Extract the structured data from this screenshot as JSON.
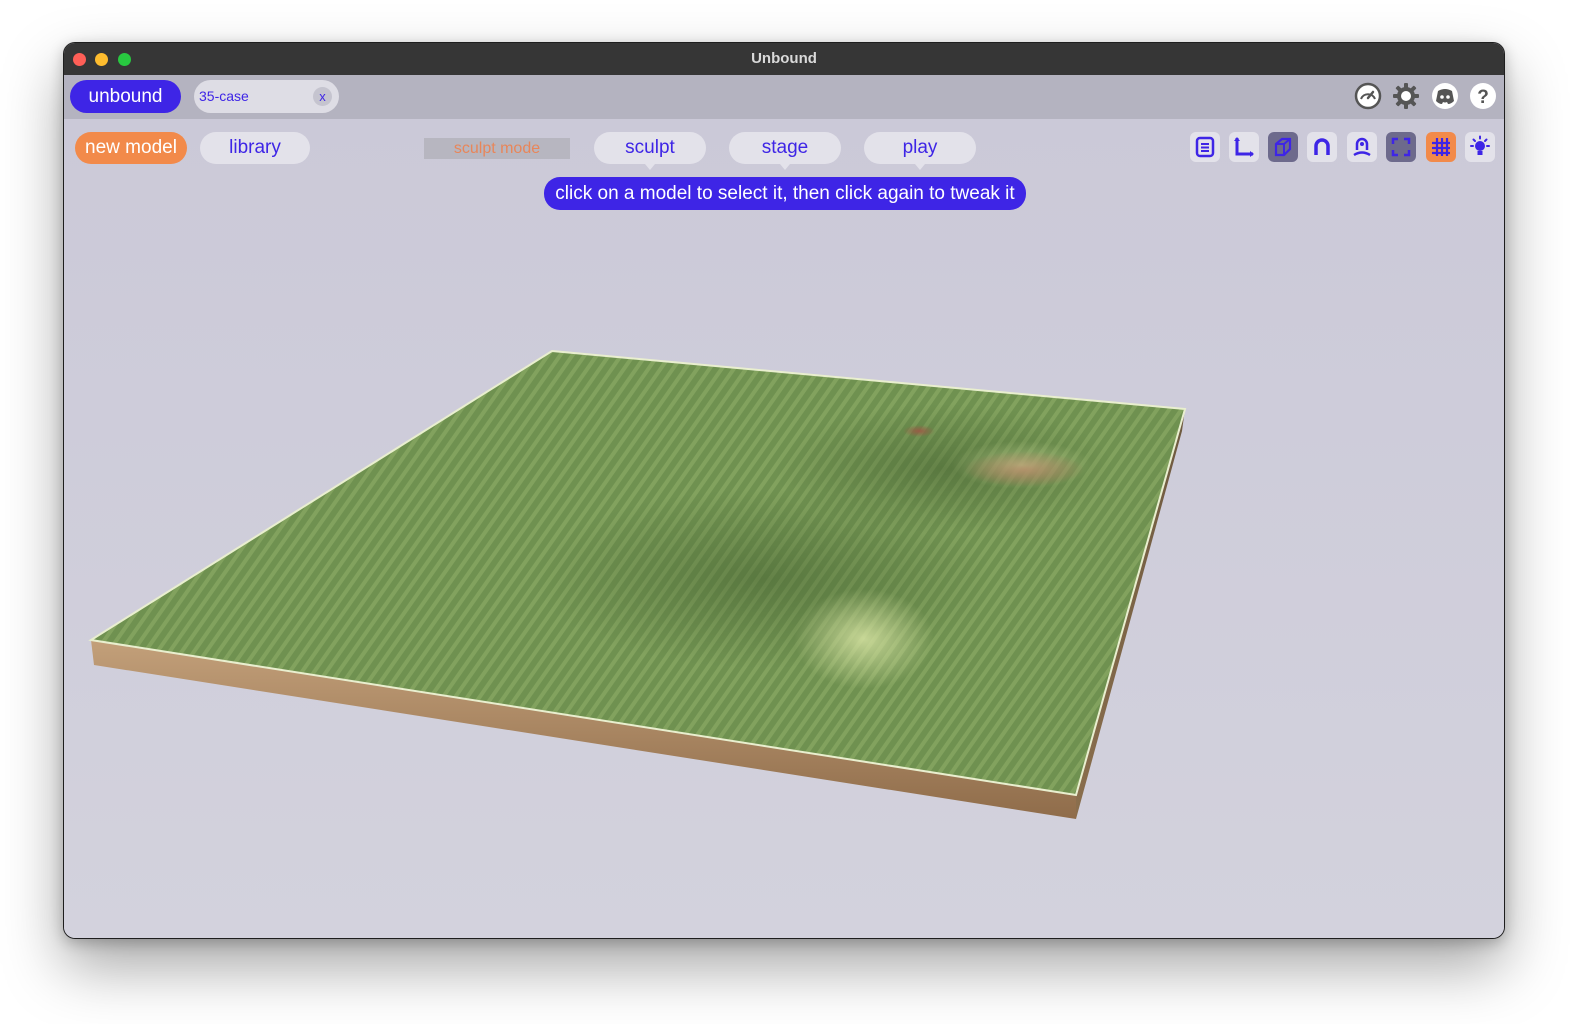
{
  "window": {
    "title": "Unbound"
  },
  "topbar": {
    "brand_label": "unbound",
    "document_tab": {
      "name": "35-case",
      "close_label": "x"
    },
    "icons": [
      "speedometer-icon",
      "gear-icon",
      "discord-icon",
      "help-icon"
    ]
  },
  "toolbar": {
    "new_model_label": "new model",
    "library_label": "library",
    "mode_label": "sculpt mode",
    "tabs": [
      {
        "label": "sculpt"
      },
      {
        "label": "stage"
      },
      {
        "label": "play"
      }
    ],
    "hint": "click on a model to select it, then click again to tweak it",
    "tools": [
      "list-icon",
      "axes-icon",
      "cube-icon",
      "magnet-icon",
      "person-magnet-icon",
      "frame-icon",
      "grid-icon",
      "light-icon"
    ]
  },
  "colors": {
    "accent": "#3e25e6",
    "orange": "#f28a4a",
    "terrain_top": "#6f9150",
    "terrain_side": "#a07f5c"
  }
}
